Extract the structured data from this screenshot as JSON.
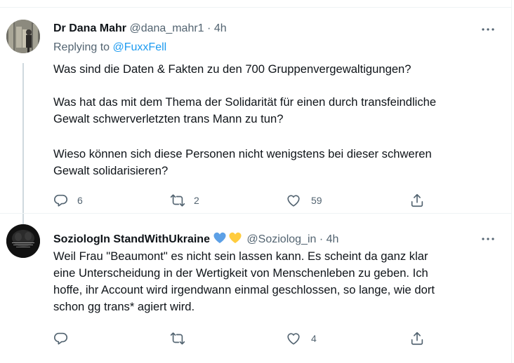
{
  "tweet1": {
    "name": "Dr Dana Mahr",
    "handle": "@dana_mahr1",
    "separator": "·",
    "time": "4h",
    "replying_prefix": "Replying to",
    "replying_to": "@FuxxFell",
    "lines": [
      "Was sind die Daten & Fakten zu den 700 Gruppenvergewaltigungen?",
      "Was hat das mit dem Thema der Solidarität für einen durch transfeindliche",
      "Gewalt schwerverletzten trans Mann zu tun?",
      "Wieso können sich diese Personen nicht wenigstens bei dieser schweren",
      "Gewalt solidarisieren?"
    ],
    "reply_count": "6",
    "retweet_count": "2",
    "like_count": "59"
  },
  "tweet2": {
    "name": "SoziologIn StandWithUkraine",
    "handle": "@Soziolog_in",
    "separator": "·",
    "time": "4h",
    "lines": [
      "Weil Frau \"Beaumont\" es nicht sein lassen kann. Es scheint da ganz klar",
      "eine Unterscheidung in der Wertigkeit von Menschenleben zu geben. Ich",
      "hoffe, ihr Account wird irgendwann einmal geschlossen, so lange, wie dort",
      "schon gg trans* agiert wird."
    ],
    "like_count": "4",
    "avatar_text": "SOMETIMES NEVER LEAVE OUT OF STYLE"
  },
  "colors": {
    "text": "#0f1419",
    "secondary": "#536471",
    "link": "#1d9bf0",
    "heart_blue": "#5da0e6",
    "heart_yellow": "#ffcc3e"
  }
}
